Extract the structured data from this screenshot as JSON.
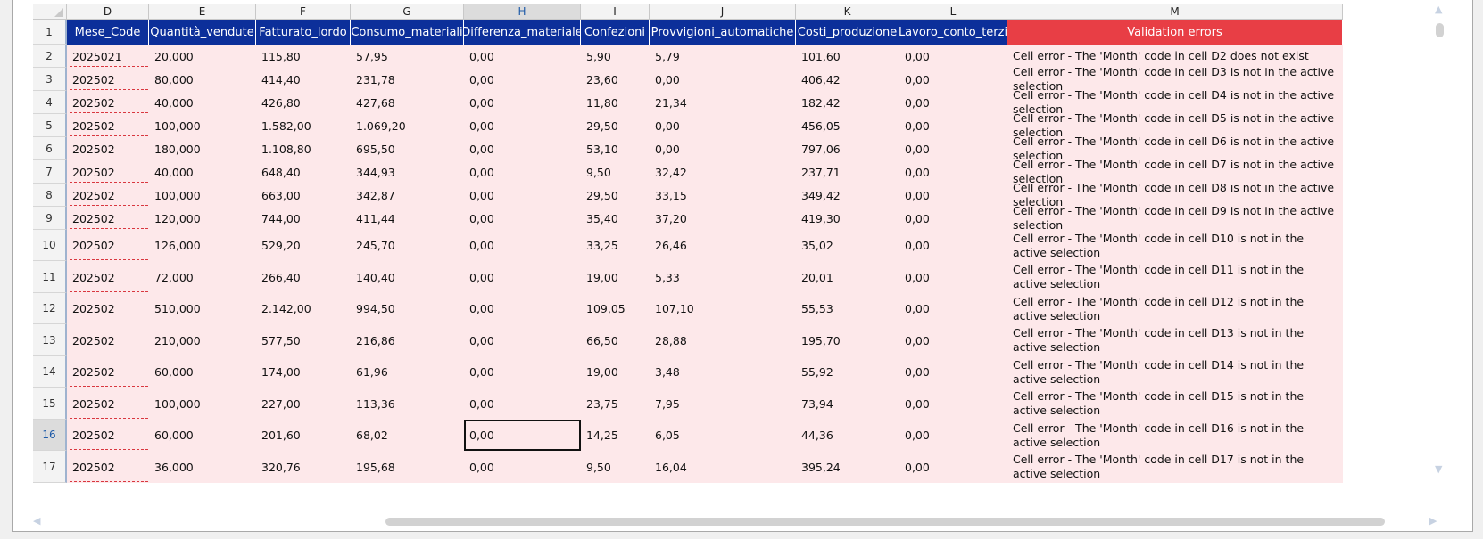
{
  "columns": [
    {
      "letter": "D",
      "header": "Mese_Code"
    },
    {
      "letter": "E",
      "header": "Quantità_vendute"
    },
    {
      "letter": "F",
      "header": "Fatturato_lordo"
    },
    {
      "letter": "G",
      "header": "Consumo_materiali"
    },
    {
      "letter": "H",
      "header": "Differenza_materiale"
    },
    {
      "letter": "I",
      "header": "Confezioni"
    },
    {
      "letter": "J",
      "header": "Provvigioni_automatiche"
    },
    {
      "letter": "K",
      "header": "Costi_produzione"
    },
    {
      "letter": "L",
      "header": "Lavoro_conto_terzi"
    },
    {
      "letter": "M",
      "header": "Validation errors"
    }
  ],
  "header_row_number": "1",
  "selected_column": "H",
  "selected_row": "16",
  "rows": [
    {
      "num": "2",
      "cells": [
        "2025021",
        "20,000",
        "115,80",
        "57,95",
        "0,00",
        "5,90",
        "5,79",
        "101,60",
        "0,00",
        "Cell error - The 'Month' code in cell D2 does not exist"
      ]
    },
    {
      "num": "3",
      "cells": [
        "202502",
        "80,000",
        "414,40",
        "231,78",
        "0,00",
        "23,60",
        "0,00",
        "406,42",
        "0,00",
        "Cell error - The 'Month' code in cell D3 is not in the active selection"
      ]
    },
    {
      "num": "4",
      "cells": [
        "202502",
        "40,000",
        "426,80",
        "427,68",
        "0,00",
        "11,80",
        "21,34",
        "182,42",
        "0,00",
        "Cell error - The 'Month' code in cell D4 is not in the active selection"
      ]
    },
    {
      "num": "5",
      "cells": [
        "202502",
        "100,000",
        "1.582,00",
        "1.069,20",
        "0,00",
        "29,50",
        "0,00",
        "456,05",
        "0,00",
        "Cell error - The 'Month' code in cell D5 is not in the active selection"
      ]
    },
    {
      "num": "6",
      "cells": [
        "202502",
        "180,000",
        "1.108,80",
        "695,50",
        "0,00",
        "53,10",
        "0,00",
        "797,06",
        "0,00",
        "Cell error - The 'Month' code in cell D6 is not in the active selection"
      ]
    },
    {
      "num": "7",
      "cells": [
        "202502",
        "40,000",
        "648,40",
        "344,93",
        "0,00",
        "9,50",
        "32,42",
        "237,71",
        "0,00",
        "Cell error - The 'Month' code in cell D7 is not in the active selection"
      ]
    },
    {
      "num": "8",
      "cells": [
        "202502",
        "100,000",
        "663,00",
        "342,87",
        "0,00",
        "29,50",
        "33,15",
        "349,42",
        "0,00",
        "Cell error - The 'Month' code in cell D8 is not in the active selection"
      ]
    },
    {
      "num": "9",
      "cells": [
        "202502",
        "120,000",
        "744,00",
        "411,44",
        "0,00",
        "35,40",
        "37,20",
        "419,30",
        "0,00",
        "Cell error - The 'Month' code in cell D9 is not in the active selection"
      ]
    },
    {
      "num": "10",
      "cells": [
        "202502",
        "126,000",
        "529,20",
        "245,70",
        "0,00",
        "33,25",
        "26,46",
        "35,02",
        "0,00",
        "Cell error - The 'Month' code in cell D10 is not in the active selection"
      ]
    },
    {
      "num": "11",
      "cells": [
        "202502",
        "72,000",
        "266,40",
        "140,40",
        "0,00",
        "19,00",
        "5,33",
        "20,01",
        "0,00",
        "Cell error - The 'Month' code in cell D11 is not in the active selection"
      ]
    },
    {
      "num": "12",
      "cells": [
        "202502",
        "510,000",
        "2.142,00",
        "994,50",
        "0,00",
        "109,05",
        "107,10",
        "55,53",
        "0,00",
        "Cell error - The 'Month' code in cell D12 is not in the active selection"
      ]
    },
    {
      "num": "13",
      "cells": [
        "202502",
        "210,000",
        "577,50",
        "216,86",
        "0,00",
        "66,50",
        "28,88",
        "195,70",
        "0,00",
        "Cell error - The 'Month' code in cell D13 is not in the active selection"
      ]
    },
    {
      "num": "14",
      "cells": [
        "202502",
        "60,000",
        "174,00",
        "61,96",
        "0,00",
        "19,00",
        "3,48",
        "55,92",
        "0,00",
        "Cell error - The 'Month' code in cell D14 is not in the active selection"
      ]
    },
    {
      "num": "15",
      "cells": [
        "202502",
        "100,000",
        "227,00",
        "113,36",
        "0,00",
        "23,75",
        "7,95",
        "73,94",
        "0,00",
        "Cell error - The 'Month' code in cell D15 is not in the active selection"
      ]
    },
    {
      "num": "16",
      "cells": [
        "202502",
        "60,000",
        "201,60",
        "68,02",
        "0,00",
        "14,25",
        "6,05",
        "44,36",
        "0,00",
        "Cell error - The 'Month' code in cell D16 is not in the active selection"
      ]
    },
    {
      "num": "17",
      "cells": [
        "202502",
        "36,000",
        "320,76",
        "195,68",
        "0,00",
        "9,50",
        "16,04",
        "395,24",
        "0,00",
        "Cell error - The 'Month' code in cell D17 is not in the active selection"
      ]
    }
  ],
  "colors": {
    "header_bg": "#0c2f9a",
    "validation_header_bg": "#e83e45",
    "error_row_bg": "#fde8ea"
  },
  "icons": {
    "scroll_up": "triangle-up",
    "scroll_down": "triangle-down",
    "scroll_left": "triangle-left",
    "scroll_right": "triangle-right"
  }
}
